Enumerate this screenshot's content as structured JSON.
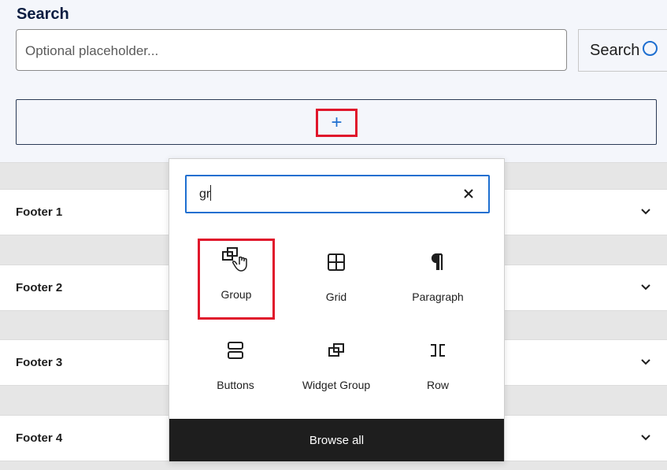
{
  "search_widget": {
    "title": "Search",
    "input_placeholder": "Optional placeholder...",
    "button_label": "Search",
    "appender_symbol": "+"
  },
  "footers": [
    {
      "label": "Footer 1"
    },
    {
      "label": "Footer 2"
    },
    {
      "label": "Footer 3"
    },
    {
      "label": "Footer 4"
    }
  ],
  "inserter": {
    "search_value": "gr",
    "clear_icon": "close-icon",
    "blocks": [
      {
        "label": "Group",
        "icon": "group-icon",
        "selected": true
      },
      {
        "label": "Grid",
        "icon": "grid-icon",
        "selected": false
      },
      {
        "label": "Paragraph",
        "icon": "paragraph-icon",
        "selected": false
      },
      {
        "label": "Buttons",
        "icon": "buttons-icon",
        "selected": false
      },
      {
        "label": "Widget Group",
        "icon": "widget-group-icon",
        "selected": false
      },
      {
        "label": "Row",
        "icon": "row-icon",
        "selected": false
      }
    ],
    "browse_all_label": "Browse all"
  },
  "colors": {
    "accent": "#1e6fd0",
    "highlight": "#e0162b",
    "title": "#0b1e42",
    "dark": "#1e1e1e"
  }
}
